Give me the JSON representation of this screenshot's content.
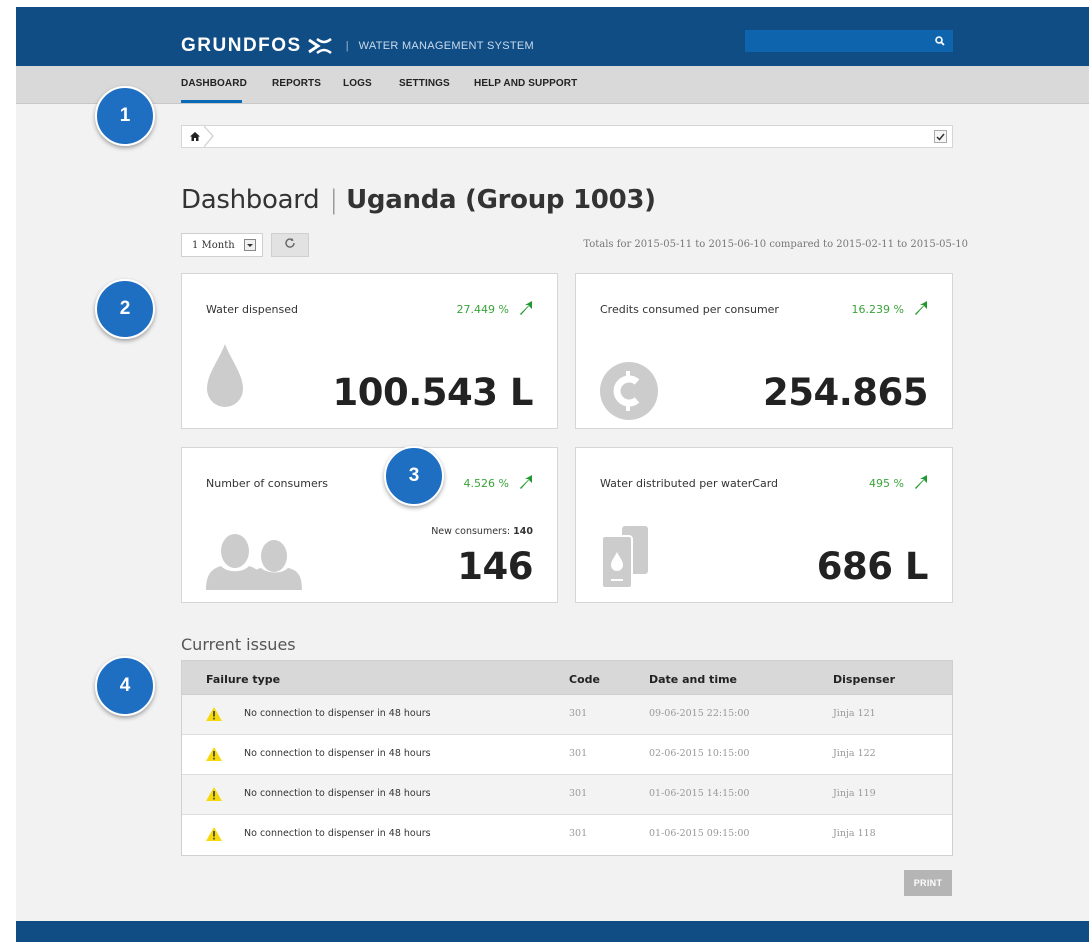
{
  "header": {
    "brand": "GRUNDFOS",
    "separator": "|",
    "subtitle": "WATER MANAGEMENT SYSTEM",
    "search_placeholder": "",
    "brand_color": "#104d85"
  },
  "nav": {
    "items": [
      "DASHBOARD",
      "REPORTS",
      "LOGS",
      "SETTINGS",
      "HELP AND SUPPORT"
    ],
    "active": "DASHBOARD"
  },
  "page": {
    "title": "Dashboard",
    "title_sep": "|",
    "group": "Uganda (Group 1003)"
  },
  "controls": {
    "period": "1 Month",
    "totals_text": "Totals for 2015-05-11 to 2015-06-10 compared to 2015-02-11 to 2015-05-10"
  },
  "cards": [
    {
      "title": "Water dispensed",
      "change": "27.449 %",
      "value": "100.543 L",
      "icon": "water-drop-icon"
    },
    {
      "title": "Credits consumed per consumer",
      "change": "16.239 %",
      "value": "254.865",
      "icon": "credits-coin-icon"
    },
    {
      "title": "Number of consumers",
      "change": "4.526 %",
      "value": "146",
      "sub_label": "New consumers:",
      "sub_value": "140",
      "icon": "consumers-icon"
    },
    {
      "title": "Water distributed per waterCard",
      "change": "495 %",
      "value": "686 L",
      "icon": "watercard-icon"
    }
  ],
  "issues": {
    "title": "Current issues",
    "columns": [
      "Failure type",
      "Code",
      "Date and time",
      "Dispenser"
    ],
    "rows": [
      {
        "failure": "No connection to dispenser in 48 hours",
        "code": "301",
        "datetime": "09-06-2015 22:15:00",
        "dispenser": "Jinja 121"
      },
      {
        "failure": "No connection to dispenser in 48 hours",
        "code": "301",
        "datetime": "02-06-2015 10:15:00",
        "dispenser": "Jinja 122"
      },
      {
        "failure": "No connection to dispenser in 48 hours",
        "code": "301",
        "datetime": "01-06-2015 14:15:00",
        "dispenser": "Jinja 119"
      },
      {
        "failure": "No connection to dispenser in 48 hours",
        "code": "301",
        "datetime": "01-06-2015 09:15:00",
        "dispenser": "Jinja 118"
      }
    ]
  },
  "actions": {
    "print": "PRINT"
  },
  "callouts": [
    "1",
    "2",
    "3",
    "4"
  ],
  "colors": {
    "accent": "#1e6fc2",
    "positive": "#3aa43a",
    "warning": "#f5d90a"
  }
}
